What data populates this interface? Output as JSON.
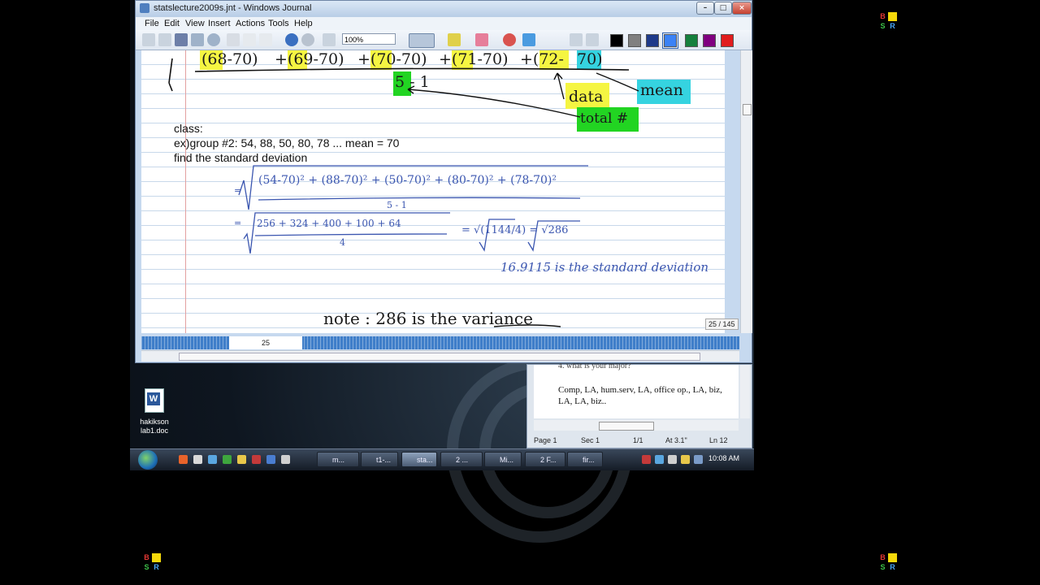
{
  "journal": {
    "title": "statslecture2009s.jnt - Windows Journal",
    "menu": [
      "File",
      "Edit",
      "View",
      "Insert",
      "Actions",
      "Tools",
      "Help"
    ],
    "zoom": "100%",
    "colors": [
      "#000000",
      "#808080",
      "#1e3a8a",
      "#3b82f6",
      "#15803d",
      "#800080",
      "#e11d1d"
    ],
    "page_indicator": "25 / 145",
    "page_number": "25",
    "typed": {
      "line1": "class:",
      "line2": "ex)group #2: 54, 88, 50, 80, 78 ... mean = 70",
      "line3": "find the standard deviation"
    },
    "ink": {
      "top_row": [
        "(68-70)",
        "+(69-70)",
        "+(70-70)",
        "+(71-70)",
        "+(72-",
        "70)"
      ],
      "divisor": "5 - 1",
      "label_data": "data",
      "label_mean": "mean",
      "label_total": "total #",
      "formula_num": "(54-70)² + (88-70)² + (50-70)² + (80-70)² + (78-70)²",
      "formula_den": "5 - 1",
      "step2_num": "256 + 324 + 400 + 100 + 64",
      "step2_den": "4",
      "eq_prefix": "=",
      "step3": "= √(1144/4) = √286",
      "result": "16.9115 is the standard deviation",
      "note": "note : 286  is the variance"
    }
  },
  "word": {
    "partial_line": "4. what is your major?",
    "text": "Comp, LA, hum.serv, LA, office op., LA, biz, LA, LA, biz..",
    "status": {
      "page": "Page 1",
      "sec": "Sec 1",
      "count": "1/1",
      "at": "At 3.1\"",
      "ln": "Ln 12"
    }
  },
  "desktop_icon": {
    "label": "hakikson lab1.doc"
  },
  "taskbar": {
    "buttons": [
      "m...",
      "t1-...",
      "sta...",
      "2 ...",
      "Mi...",
      "2 F...",
      "fir..."
    ],
    "clock": "10:08 AM"
  },
  "logo": {
    "b": "B",
    "s": "S",
    "r": "R"
  }
}
